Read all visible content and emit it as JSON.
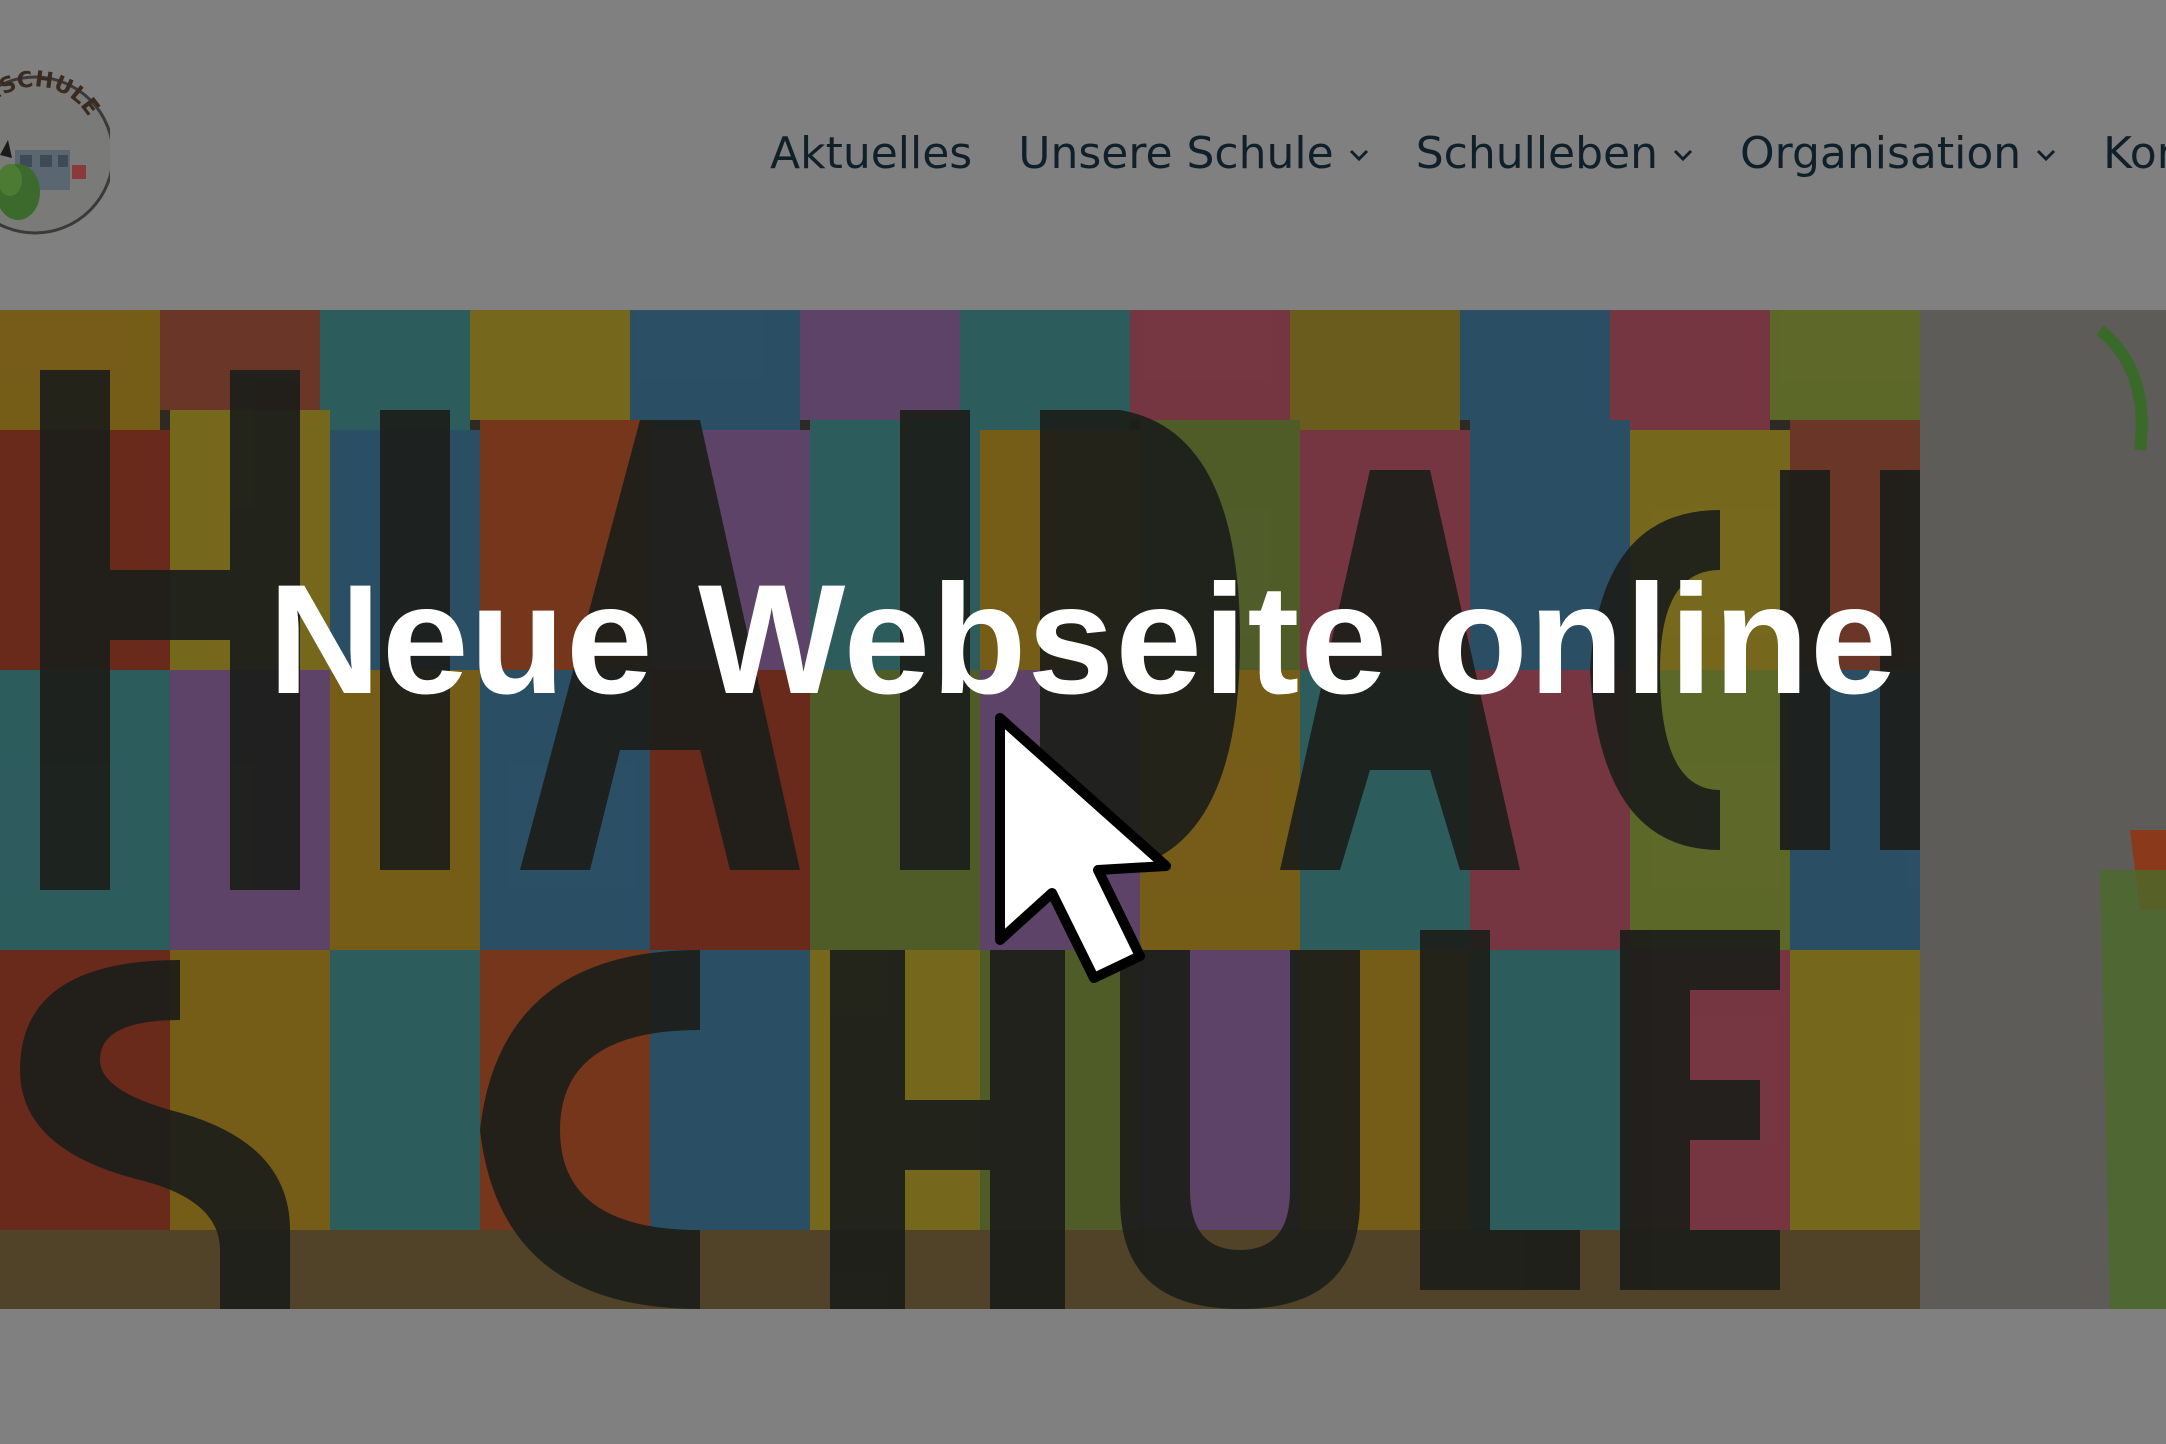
{
  "header": {
    "logo_alt": "Haidachschule logo",
    "logo_text": "CHSCHULE",
    "nav": [
      {
        "label": "Aktuelles",
        "has_dropdown": false
      },
      {
        "label": "Unsere Schule",
        "has_dropdown": true
      },
      {
        "label": "Schulleben",
        "has_dropdown": true
      },
      {
        "label": "Organisation",
        "has_dropdown": true
      },
      {
        "label": "Kontakt",
        "has_dropdown": false
      }
    ]
  },
  "hero": {
    "title": "Neue Webseite online"
  },
  "colors": {
    "overlay_gray": "#808080",
    "nav_text": "#10202a",
    "title_text": "#ffffff"
  },
  "icons": [
    "chevron-down-icon",
    "mouse-cursor-icon"
  ]
}
